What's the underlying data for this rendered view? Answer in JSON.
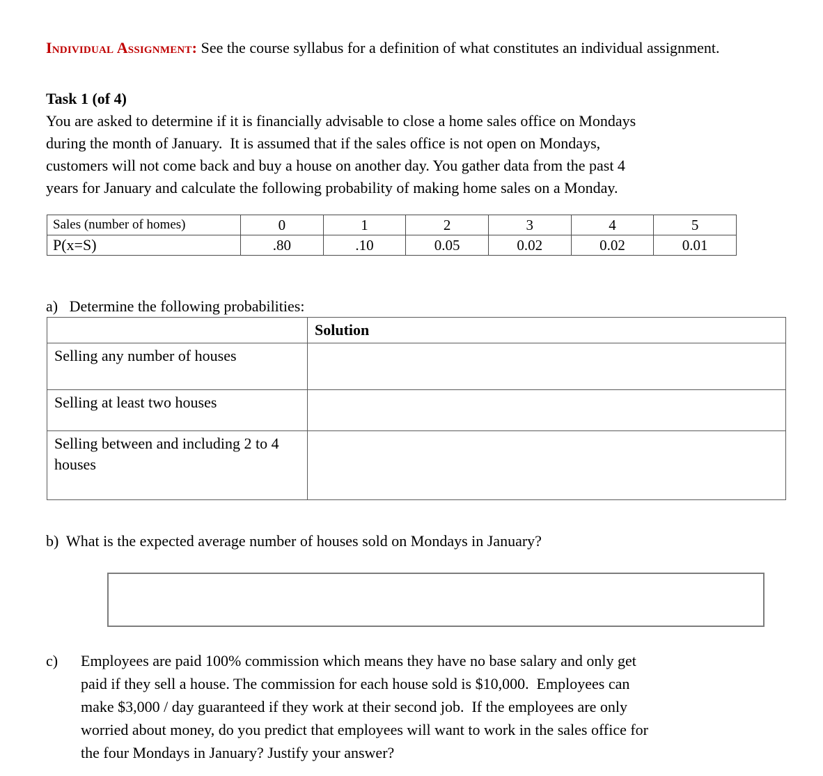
{
  "document": {
    "intro": {
      "label": "Individual Assignment:",
      "text": " See the course syllabus for a definition of what constitutes an individual assignment."
    },
    "task": {
      "heading": "Task 1 (of 4)",
      "lines": [
        "You are asked to determine if it is financially advisable to close a home sales office on Mondays",
        "during the month of January.  It is assumed that if the sales office is not open on Mondays,",
        "customers will not come back and buy a house on another day. You gather data from the past 4",
        "years for January and calculate the following probability of making home sales on a Monday."
      ]
    },
    "prob_table": {
      "row_labels": [
        "Sales (number of homes)",
        "P(x=S)"
      ],
      "sales": [
        "0",
        "1",
        "2",
        "3",
        "4",
        "5"
      ],
      "probabilities": [
        ".80",
        ".10",
        "0.05",
        "0.02",
        "0.02",
        "0.01"
      ]
    },
    "part_a": {
      "marker": "a)",
      "text": "Determine the following probabilities:",
      "full": "a)   Determine the following probabilities:",
      "table": {
        "header": {
          "label": "",
          "solution": "Solution"
        },
        "rows": [
          {
            "label": "Selling any number of houses",
            "solution": ""
          },
          {
            "label": "Selling at least two houses",
            "solution": ""
          },
          {
            "label": "Selling between and including 2 to 4 houses",
            "solution": ""
          }
        ]
      }
    },
    "part_b": {
      "marker": "b)",
      "full": "b)  What is the expected average number of houses sold on Mondays in January?",
      "answer": ""
    },
    "part_c": {
      "marker": "c)",
      "lines": [
        "Employees are paid 100% commission which means they have no base salary and only get",
        "paid if they sell a house. The commission for each house sold is $10,000.  Employees can",
        "make $3,000 / day guaranteed if they work at their second job.  If the employees are only",
        "worried about money, do you predict that employees will want to work in the sales office for",
        "the four Mondays in January? Justify your answer?"
      ]
    },
    "colors": {
      "heading_red": "#C00000",
      "text": "#000000",
      "table_border": "#4a4a4a",
      "box_border": "#7c7c7c"
    }
  }
}
